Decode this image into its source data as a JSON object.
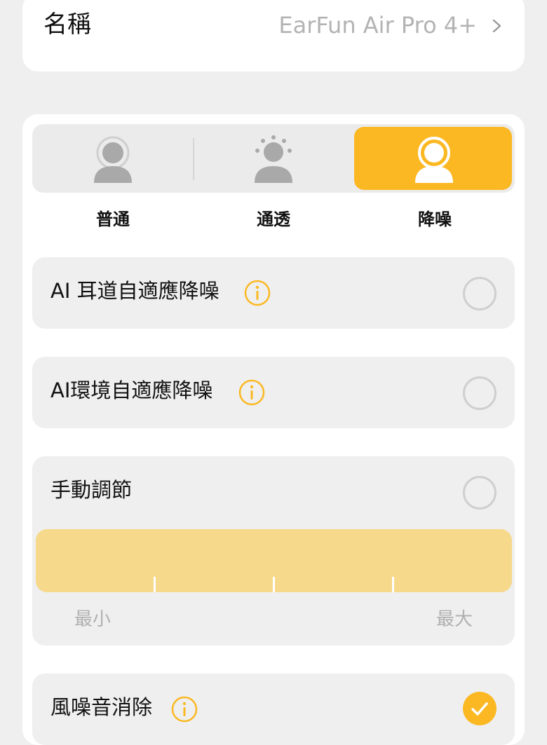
{
  "name_row": {
    "label": "名稱",
    "value": "EarFun Air Pro 4+"
  },
  "modes": [
    {
      "label": "普通",
      "icon": "person-icon",
      "active": false
    },
    {
      "label": "通透",
      "icon": "person-sun-icon",
      "active": false
    },
    {
      "label": "降噪",
      "icon": "person-ring-icon",
      "active": true
    }
  ],
  "options": {
    "ai_ear": {
      "label": "AI 耳道自適應降噪",
      "selected": false
    },
    "ai_env": {
      "label": "AI環境自適應降噪",
      "selected": false
    },
    "manual": {
      "label": "手動調節",
      "selected": false,
      "min_label": "最小",
      "max_label": "最大"
    },
    "wind": {
      "label": "風噪音消除",
      "checked": true
    }
  },
  "colors": {
    "accent": "#fbb822",
    "slider_track": "#f7d98c"
  }
}
